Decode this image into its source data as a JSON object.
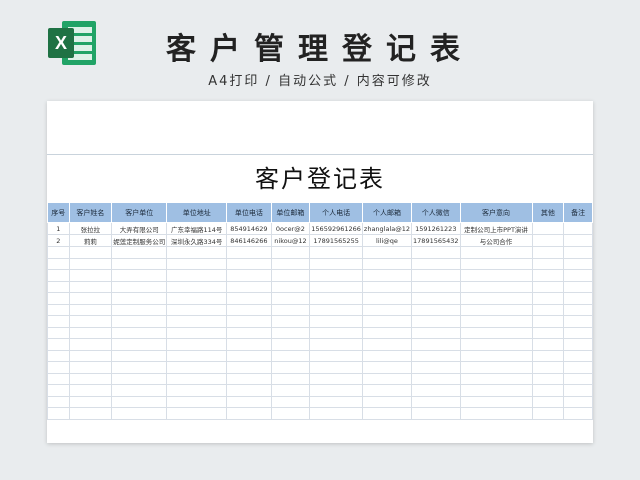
{
  "header": {
    "title": "客户管理登记表",
    "subtitle": "A4打印 / 自动公式 / 内容可修改",
    "logo_letter": "X"
  },
  "sheet": {
    "title": "客户登记表",
    "columns": [
      "序号",
      "客户姓名",
      "客户单位",
      "单位地址",
      "单位电话",
      "单位邮箱",
      "个人电话",
      "个人邮箱",
      "个人微信",
      "客户意向",
      "其他",
      "备注"
    ],
    "rows": [
      [
        "1",
        "张拉拉",
        "大弄有限公司",
        "广东幸福路114号",
        "854914629",
        "0ocer@2",
        "156592961266",
        "zhanglala@12",
        "1591261223",
        "定制公司上市PPT演讲",
        "",
        ""
      ],
      [
        "2",
        "莉莉",
        "妮莲定制服务公司",
        "深圳永久路334号",
        "846146266",
        "nikou@12",
        "17891565255",
        "lili@qe",
        "17891565432",
        "与公司合作",
        "",
        ""
      ]
    ],
    "empty_rows": 15
  },
  "colors": {
    "excel_green": "#1f7244",
    "header_fill": "#9fbfe3"
  }
}
